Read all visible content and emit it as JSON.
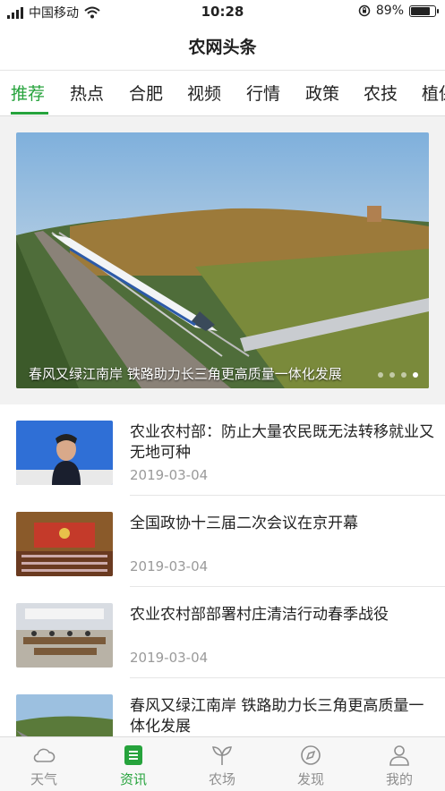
{
  "status": {
    "carrier": "中国移动",
    "time": "10:28",
    "battery": "89%",
    "battery_level": 0.89
  },
  "header": {
    "title": "农网头条"
  },
  "tabs": [
    {
      "label": "推荐"
    },
    {
      "label": "热点"
    },
    {
      "label": "合肥"
    },
    {
      "label": "视频"
    },
    {
      "label": "行情"
    },
    {
      "label": "政策"
    },
    {
      "label": "农技"
    },
    {
      "label": "植保"
    }
  ],
  "banner": {
    "caption": "春风又绿江南岸 铁路助力长三角更高质量一体化发展",
    "dots": 4,
    "active_dot": 3
  },
  "news": [
    {
      "title": "农业农村部：防止大量农民既无法转移就业又无地可种",
      "date": "2019-03-04"
    },
    {
      "title": "全国政协十三届二次会议在京开幕",
      "date": "2019-03-04"
    },
    {
      "title": "农业农村部部署村庄清洁行动春季战役",
      "date": "2019-03-04"
    },
    {
      "title": "春风又绿江南岸 铁路助力长三角更高质量一体化发展",
      "date": ""
    }
  ],
  "tabbar": [
    {
      "label": "天气",
      "icon": "cloud-icon"
    },
    {
      "label": "资讯",
      "icon": "news-icon"
    },
    {
      "label": "农场",
      "icon": "sprout-icon"
    },
    {
      "label": "发现",
      "icon": "compass-icon"
    },
    {
      "label": "我的",
      "icon": "person-icon"
    }
  ],
  "colors": {
    "accent": "#26a33c"
  }
}
